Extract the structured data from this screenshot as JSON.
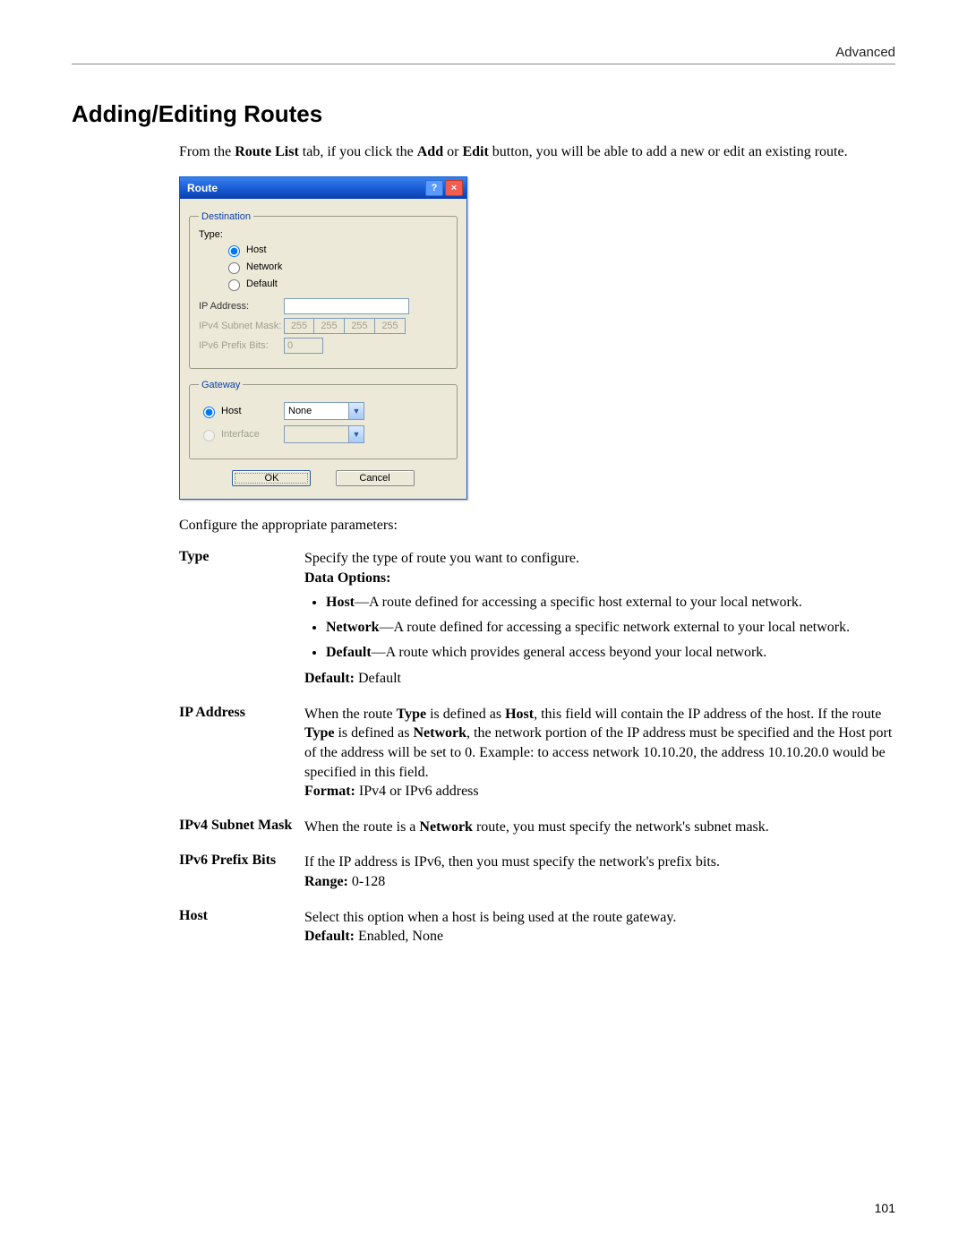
{
  "header": {
    "section": "Advanced"
  },
  "title": "Adding/Editing Routes",
  "intro": {
    "pre": "From the ",
    "tab": "Route List",
    "mid1": " tab, if you click the ",
    "add": "Add",
    "mid2": " or ",
    "edit": "Edit",
    "post": " button, you will be able to add a new or edit an existing route."
  },
  "dialog": {
    "title": "Route",
    "help": "?",
    "close": "×",
    "dest_legend": "Destination",
    "type_label": "Type:",
    "type_host": "Host",
    "type_network": "Network",
    "type_default": "Default",
    "ip_label": "IP Address:",
    "mask_label": "IPv4 Subnet Mask:",
    "mask": {
      "o1": "255",
      "o2": "255",
      "o3": "255",
      "o4": "255"
    },
    "prefix_label": "IPv6 Prefix Bits:",
    "prefix_value": "0",
    "gw_legend": "Gateway",
    "gw_host": "Host",
    "gw_interface": "Interface",
    "gw_host_value": "None",
    "ok": "OK",
    "cancel": "Cancel"
  },
  "configure_line": "Configure the appropriate parameters:",
  "params": {
    "type": {
      "name": "Type",
      "intro": "Specify the type of route you want to configure.",
      "options_label": "Data Options:",
      "opt_host_b": "Host",
      "opt_host_t": "—A route defined for accessing a specific host external to your local network.",
      "opt_network_b": "Network",
      "opt_network_t": "—A route defined for accessing a specific network external to your local network.",
      "opt_default_b": "Default",
      "opt_default_t": "—A route which provides general access beyond your local network.",
      "default_label": "Default:",
      "default_value": " Default"
    },
    "ip": {
      "name": "IP Address",
      "p1a": "When the route ",
      "p1b": "Type",
      "p1c": " is defined as ",
      "p1d": "Host",
      "p1e": ", this field will contain the IP address of the host. If the route ",
      "p1f": "Type",
      "p1g": " is defined as ",
      "p1h": "Network",
      "p1i": ", the network portion of the IP address must be specified and the Host port of the address will be set to 0. Example: to access network 10.10.20, the address 10.10.20.0 would be specified in this field.",
      "format_label": "Format:",
      "format_value": " IPv4 or IPv6 address"
    },
    "mask": {
      "name": "IPv4 Subnet Mask",
      "t1": "When the route is a ",
      "t2": "Network",
      "t3": " route, you must specify the network's subnet mask."
    },
    "prefix": {
      "name": "IPv6 Prefix Bits",
      "t": "If the IP address is IPv6, then you must specify the network's prefix bits.",
      "range_label": "Range:",
      "range_value": " 0-128"
    },
    "host": {
      "name": "Host",
      "t": "Select this option when a host is being used at the route gateway.",
      "default_label": "Default:",
      "default_value": " Enabled, None"
    }
  },
  "page_number": "101"
}
